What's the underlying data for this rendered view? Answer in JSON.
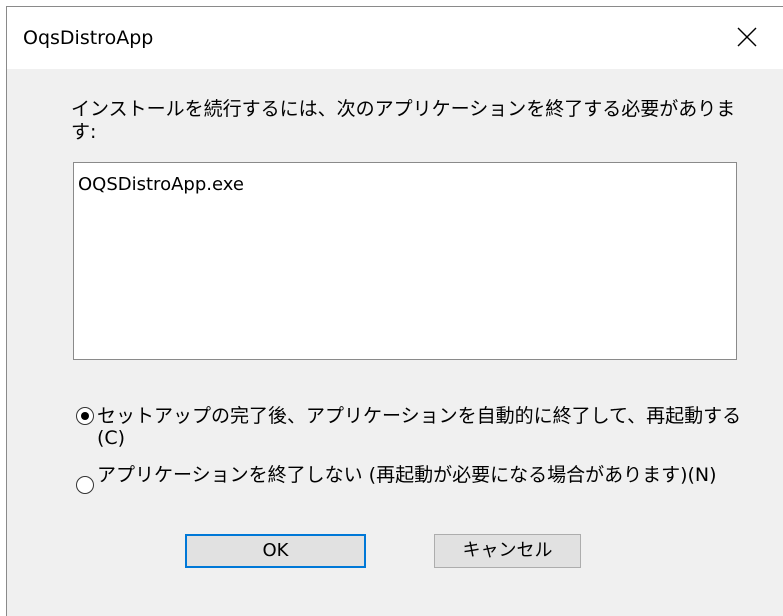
{
  "window": {
    "title": "OqsDistroApp"
  },
  "message": "インストールを続行するには、次のアプリケーションを終了する必要があります:",
  "applications": [
    "OQSDistroApp.exe"
  ],
  "options": [
    {
      "label": "セットアップの完了後、アプリケーションを自動的に終了して、再起動する(C)",
      "selected": true
    },
    {
      "label": "アプリケーションを終了しない (再起動が必要になる場合があります)(N)",
      "selected": false
    }
  ],
  "buttons": {
    "ok_label": "OK",
    "cancel_label": "キャンセル"
  },
  "colors": {
    "dialog_background": "#f0f0f0",
    "focus_border": "#0078d7"
  },
  "icons": {
    "close": "close-icon"
  }
}
